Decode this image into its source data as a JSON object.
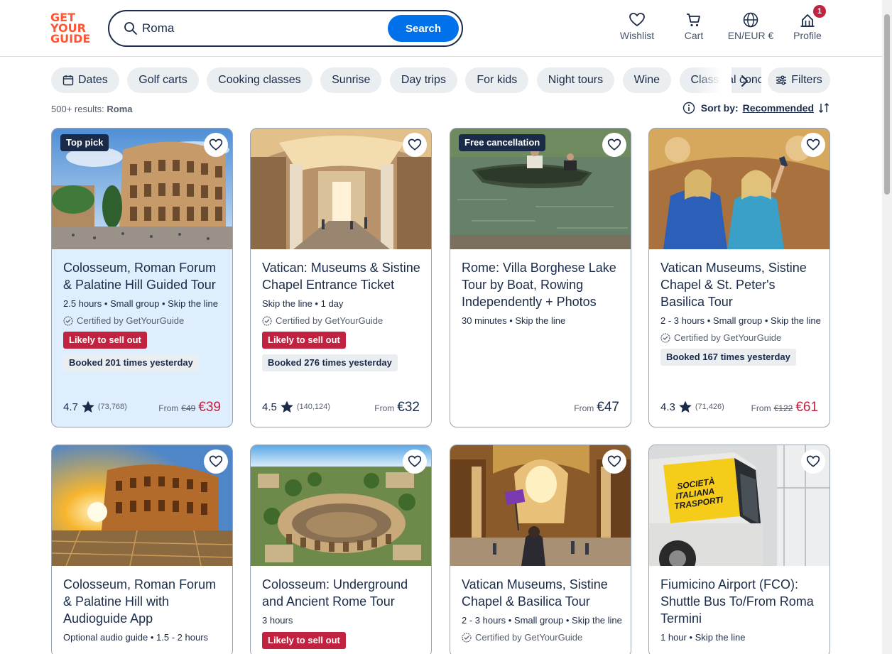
{
  "header": {
    "logo": [
      "GET",
      "YOUR",
      "GUIDE"
    ],
    "search_value": "Roma",
    "search_button": "Search",
    "nav": {
      "wishlist": "Wishlist",
      "cart": "Cart",
      "language": "EN/EUR €",
      "profile": "Profile",
      "profile_badge": "1"
    }
  },
  "chips": {
    "items": [
      "Dates",
      "Golf carts",
      "Cooking classes",
      "Sunrise",
      "Day trips",
      "For kids",
      "Night tours",
      "Wine",
      "Classical concerts"
    ],
    "filters_label": "Filters"
  },
  "results": {
    "count": "500+ results:",
    "query": "Roma",
    "sort_label": "Sort by:",
    "sort_value": "Recommended"
  },
  "cards": [
    {
      "badge": "Top pick",
      "title": "Colosseum, Roman Forum & Palatine Hill Guided Tour",
      "meta": "2.5 hours • Small group • Skip the line",
      "certified": "Certified by GetYourGuide",
      "sell": "Likely to sell out",
      "booked": "Booked 201 times yesterday",
      "rating": "4.7",
      "reviews": "(73,768)",
      "from": "From",
      "old_price": "€49",
      "price": "€39"
    },
    {
      "title": "Vatican: Museums & Sistine Chapel Entrance Ticket",
      "meta": "Skip the line • 1 day",
      "certified": "Certified by GetYourGuide",
      "sell": "Likely to sell out",
      "booked": "Booked 276 times yesterday",
      "rating": "4.5",
      "reviews": "(140,124)",
      "from": "From",
      "price": "€32"
    },
    {
      "badge": "Free cancellation",
      "title": "Rome: Villa Borghese Lake Tour by Boat, Rowing Independently + Photos",
      "meta": "30 minutes • Skip the line",
      "from": "From",
      "price": "€47"
    },
    {
      "title": "Vatican Museums, Sistine Chapel & St. Peter's Basilica Tour",
      "meta": "2 - 3 hours • Small group • Skip the line",
      "certified": "Certified by GetYourGuide",
      "booked": "Booked 167 times yesterday",
      "rating": "4.3",
      "reviews": "(71,426)",
      "from": "From",
      "old_price": "€122",
      "price": "€61"
    },
    {
      "title": "Colosseum, Roman Forum & Palatine Hill with Audioguide App",
      "meta": "Optional audio guide • 1.5 - 2 hours"
    },
    {
      "title": "Colosseum: Underground and Ancient Rome Tour",
      "meta": "3 hours",
      "sell": "Likely to sell out"
    },
    {
      "title": "Vatican Museums, Sistine Chapel & Basilica Tour",
      "meta": "2 - 3 hours • Small group • Skip the line",
      "certified": "Certified by GetYourGuide"
    },
    {
      "title": "Fiumicino Airport (FCO): Shuttle Bus To/From Roma Termini",
      "meta": "1 hour • Skip the line",
      "bus_text": [
        "SOCIETÀ",
        "ITALIANA",
        "TRASPORTI"
      ]
    }
  ],
  "colors": {
    "brand": "#ff5533",
    "primary": "#0071eb",
    "text": "#1a2b49",
    "sale": "#c0223f"
  }
}
